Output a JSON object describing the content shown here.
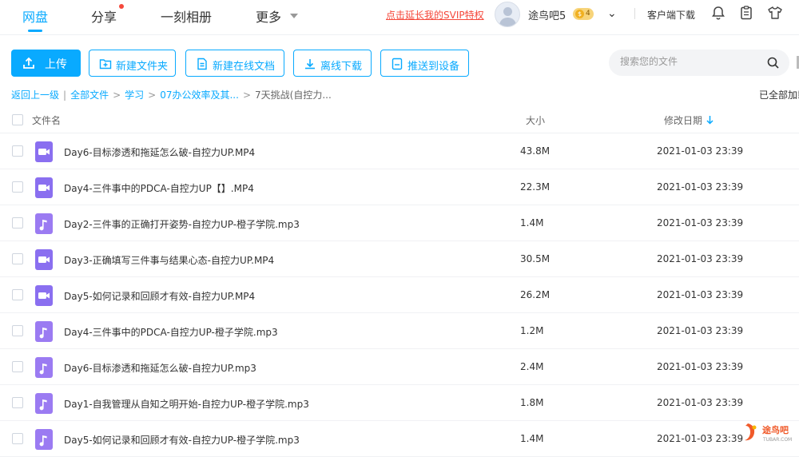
{
  "nav": {
    "tabs": [
      {
        "label": "网盘"
      },
      {
        "label": "分享"
      },
      {
        "label": "一刻相册"
      },
      {
        "label": "更多"
      }
    ],
    "svip_link": "点击延长我的SVIP特权",
    "username": "途鸟吧5",
    "vip_level": "4",
    "client_download": "客户端下载"
  },
  "toolbar": {
    "upload": "上传",
    "new_folder": "新建文件夹",
    "new_online_doc": "新建在线文档",
    "offline_download": "离线下载",
    "push_to_device": "推送到设备",
    "search_placeholder": "搜索您的文件"
  },
  "breadcrumb": {
    "back": "返回上一级",
    "all_files": "全部文件",
    "study": "学习",
    "folder": "07办公效率及其...",
    "current": "7天挑战(自控力..."
  },
  "loaded_note": "已全部加载",
  "table": {
    "columns": {
      "name": "文件名",
      "size": "大小",
      "date": "修改日期"
    },
    "sort": "date-desc",
    "rows": [
      {
        "type": "video",
        "name": "Day6-目标渗透和拖延怎么破-自控力UP.MP4",
        "size": "43.8M",
        "date": "2021-01-03 23:39"
      },
      {
        "type": "video",
        "name": "Day4-三件事中的PDCA-自控力UP【】.MP4",
        "size": "22.3M",
        "date": "2021-01-03 23:39"
      },
      {
        "type": "audio",
        "name": "Day2-三件事的正确打开姿势-自控力UP-橙子学院.mp3",
        "size": "1.4M",
        "date": "2021-01-03 23:39"
      },
      {
        "type": "video",
        "name": "Day3-正确填写三件事与结果心态-自控力UP.MP4",
        "size": "30.5M",
        "date": "2021-01-03 23:39"
      },
      {
        "type": "video",
        "name": "Day5-如何记录和回顾才有效-自控力UP.MP4",
        "size": "26.2M",
        "date": "2021-01-03 23:39"
      },
      {
        "type": "audio",
        "name": "Day4-三件事中的PDCA-自控力UP-橙子学院.mp3",
        "size": "1.2M",
        "date": "2021-01-03 23:39"
      },
      {
        "type": "audio",
        "name": "Day6-目标渗透和拖延怎么破-自控力UP.mp3",
        "size": "2.4M",
        "date": "2021-01-03 23:39"
      },
      {
        "type": "audio",
        "name": "Day1-自我管理从自知之明开始-自控力UP-橙子学院.mp3",
        "size": "1.8M",
        "date": "2021-01-03 23:39"
      },
      {
        "type": "audio",
        "name": "Day5-如何记录和回顾才有效-自控力UP-橙子学院.mp3",
        "size": "1.4M",
        "date": "2021-01-03 23:39"
      }
    ]
  },
  "watermark": {
    "text": "途鸟吧",
    "sub": "TUBAR.COM"
  },
  "colors": {
    "accent": "#09AAFF",
    "link_red": "#f5483b",
    "file_icon": "#8a6ff0"
  }
}
